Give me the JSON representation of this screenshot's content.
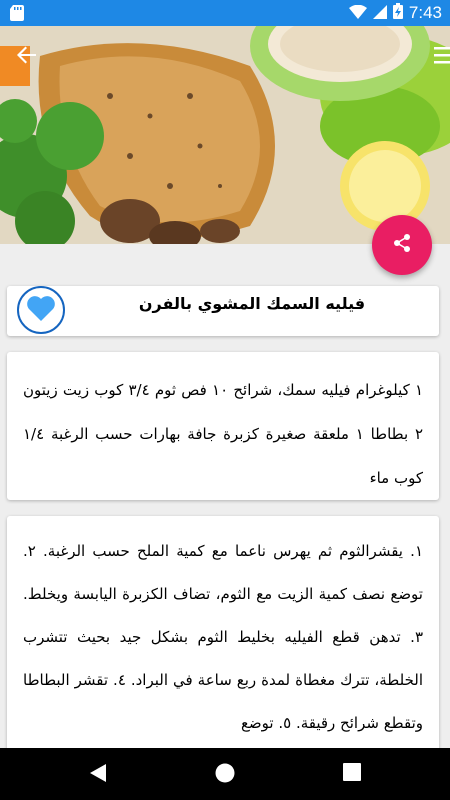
{
  "status_bar": {
    "time": "7:43",
    "icons": [
      "sd-card-icon",
      "wifi-icon",
      "cellular-icon",
      "battery-charging-icon"
    ]
  },
  "toolbar": {
    "back_icon": "arrow-back-icon",
    "menu_icon": "hamburger-menu-icon"
  },
  "share_button": {
    "icon": "share-icon",
    "color": "#e91e63"
  },
  "recipe": {
    "title": "فيليه السمك المشوي بالفرن",
    "favorite_icon": "heart-icon",
    "ingredients": "١ كيلوغرام فيليه سمك، شرائح ١٠ فص ثوم ٣/٤ كوب زيت زيتون ٢ بطاطا ١ ملعقة صغيرة كزبرة جافة بهارات حسب الرغبة ١/٤ كوب ماء",
    "steps": "١. يقشرالثوم ثم يهرس ناعما مع كمية الملح حسب الرغبة. ٢. توضع نصف كمية الزيت مع الثوم، تضاف الكزبرة اليابسة ويخلط. ٣. تدهن قطع الفيليه بخليط الثوم بشكل جيد بحيث تتشرب الخلطة، تترك مغطاة لمدة ربع ساعة في البراد. ٤. تقشر البطاطا وتقطع شرائح رقيقة. ٥. توضع"
  },
  "nav_bar": {
    "buttons": [
      "back-triangle-icon",
      "home-circle-icon",
      "recents-square-icon"
    ]
  },
  "colors": {
    "status_bar": "#1e88e5",
    "accent": "#e91e63",
    "heart": "#42a5f5"
  }
}
